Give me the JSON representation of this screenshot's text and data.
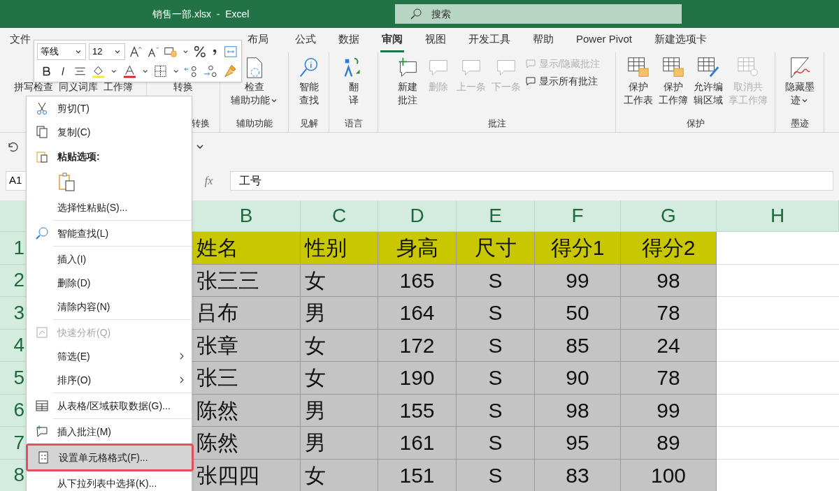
{
  "window": {
    "title": "销售一部.xlsx  -  Excel"
  },
  "search": {
    "placeholder": "搜索"
  },
  "tabs": [
    {
      "label": "文件",
      "selected": false
    },
    {
      "label": "布局",
      "selected": false
    },
    {
      "label": "公式",
      "selected": false
    },
    {
      "label": "数据",
      "selected": false
    },
    {
      "label": "审阅",
      "selected": true
    },
    {
      "label": "视图",
      "selected": false
    },
    {
      "label": "开发工具",
      "selected": false
    },
    {
      "label": "帮助",
      "selected": false
    },
    {
      "label": "Power Pivot",
      "selected": false
    },
    {
      "label": "新建选项卡",
      "selected": false
    }
  ],
  "ribbon": {
    "groups": [
      {
        "buttons": [
          {
            "lines": [
              "拼写检查"
            ],
            "disabled": false,
            "dropdown": false
          },
          {
            "lines": [
              "同义词库"
            ],
            "disabled": false,
            "dropdown": false
          },
          {
            "lines": [
              "工作簿"
            ],
            "disabled": false,
            "dropdown": false
          }
        ]
      },
      {
        "label": "转换",
        "buttons": [
          {
            "lines": [
              "转换"
            ],
            "disabled": false,
            "dropdown": false
          }
        ]
      },
      {
        "label": "辅助功能",
        "buttons": [
          {
            "lines": [
              "检查",
              "辅助功能"
            ],
            "disabled": false,
            "dropdown": true
          }
        ]
      },
      {
        "label": "见解",
        "buttons": [
          {
            "lines": [
              "智能",
              "查找"
            ],
            "disabled": false,
            "dropdown": false
          }
        ]
      },
      {
        "label": "语言",
        "buttons": [
          {
            "lines": [
              "翻",
              "译"
            ],
            "disabled": false,
            "dropdown": false
          }
        ]
      },
      {
        "label": "批注",
        "buttons": [
          {
            "lines": [
              "新建",
              "批注"
            ],
            "disabled": false,
            "dropdown": false
          },
          {
            "lines": [
              "删除"
            ],
            "disabled": true,
            "dropdown": false
          },
          {
            "lines": [
              "上一条"
            ],
            "disabled": true,
            "dropdown": false
          },
          {
            "lines": [
              "下一条"
            ],
            "disabled": true,
            "dropdown": false
          }
        ],
        "small_buttons": [
          {
            "label": "显示/隐藏批注",
            "disabled": true
          },
          {
            "label": "显示所有批注",
            "disabled": false
          }
        ]
      },
      {
        "label": "保护",
        "buttons": [
          {
            "lines": [
              "保护",
              "工作表"
            ],
            "disabled": false,
            "dropdown": false
          },
          {
            "lines": [
              "保护",
              "工作簿"
            ],
            "disabled": false,
            "dropdown": false
          },
          {
            "lines": [
              "允许编",
              "辑区域"
            ],
            "disabled": false,
            "dropdown": false
          },
          {
            "lines": [
              "取消共",
              "享工作簿"
            ],
            "disabled": true,
            "dropdown": false
          }
        ]
      },
      {
        "label": "墨迹",
        "buttons": [
          {
            "lines": [
              "隐藏墨",
              "迹"
            ],
            "disabled": false,
            "dropdown": true
          }
        ]
      }
    ]
  },
  "mini_toolbar": {
    "font": "等线",
    "size": "12"
  },
  "formula_bar": {
    "name_box": "A1",
    "function_label": "fx",
    "formula": "工号"
  },
  "sheet": {
    "columns": [
      "B",
      "C",
      "D",
      "E",
      "F",
      "G",
      "H"
    ],
    "rows": [
      {
        "number": "1",
        "kind": "header",
        "cells": [
          "姓名",
          "性别",
          "身高",
          "尺寸",
          "得分1",
          "得分2"
        ]
      },
      {
        "number": "2",
        "kind": "data",
        "cells": [
          "张三三",
          "女",
          "165",
          "S",
          "99",
          "98"
        ]
      },
      {
        "number": "3",
        "kind": "data",
        "cells": [
          "吕布",
          "男",
          "164",
          "S",
          "50",
          "78"
        ]
      },
      {
        "number": "4",
        "kind": "data",
        "cells": [
          "张章",
          "女",
          "172",
          "S",
          "85",
          "24"
        ]
      },
      {
        "number": "5",
        "kind": "data",
        "cells": [
          "张三",
          "女",
          "190",
          "S",
          "90",
          "78"
        ]
      },
      {
        "number": "6",
        "kind": "data",
        "cells": [
          "陈然",
          "男",
          "155",
          "S",
          "98",
          "99"
        ]
      },
      {
        "number": "7",
        "kind": "data",
        "cells": [
          "陈然",
          "男",
          "161",
          "S",
          "95",
          "89"
        ]
      },
      {
        "number": "8",
        "kind": "data",
        "cells": [
          "张四四",
          "女",
          "151",
          "S",
          "83",
          "100"
        ]
      }
    ]
  },
  "context_menu": {
    "items": [
      {
        "kind": "item",
        "label": "剪切(T)",
        "disabled": false,
        "selected": false,
        "submenu": false
      },
      {
        "kind": "item",
        "label": "复制(C)",
        "disabled": false,
        "selected": false,
        "submenu": false
      },
      {
        "kind": "header",
        "label": "粘贴选项:"
      },
      {
        "kind": "paste"
      },
      {
        "kind": "item",
        "label": "选择性粘贴(S)...",
        "disabled": false,
        "selected": false,
        "submenu": false
      },
      {
        "kind": "separator"
      },
      {
        "kind": "item",
        "label": "智能查找(L)",
        "disabled": false,
        "selected": false,
        "submenu": false
      },
      {
        "kind": "separator"
      },
      {
        "kind": "item",
        "label": "插入(I)",
        "disabled": false,
        "selected": false,
        "submenu": false
      },
      {
        "kind": "item",
        "label": "删除(D)",
        "disabled": false,
        "selected": false,
        "submenu": false
      },
      {
        "kind": "item",
        "label": "清除内容(N)",
        "disabled": false,
        "selected": false,
        "submenu": false
      },
      {
        "kind": "separator"
      },
      {
        "kind": "item",
        "label": "快速分析(Q)",
        "disabled": true,
        "selected": false,
        "submenu": false
      },
      {
        "kind": "item",
        "label": "筛选(E)",
        "disabled": false,
        "selected": false,
        "submenu": true
      },
      {
        "kind": "item",
        "label": "排序(O)",
        "disabled": false,
        "selected": false,
        "submenu": true
      },
      {
        "kind": "separator"
      },
      {
        "kind": "item",
        "label": "从表格/区域获取数据(G)...",
        "disabled": false,
        "selected": false,
        "submenu": false
      },
      {
        "kind": "separator"
      },
      {
        "kind": "item",
        "label": "插入批注(M)",
        "disabled": false,
        "selected": false,
        "submenu": false
      },
      {
        "kind": "item",
        "label": "设置单元格格式(F)...",
        "disabled": false,
        "selected": true,
        "submenu": false,
        "highlighted": true
      },
      {
        "kind": "item",
        "label": "从下拉列表中选择(K)...",
        "disabled": false,
        "selected": false,
        "submenu": false
      }
    ]
  }
}
